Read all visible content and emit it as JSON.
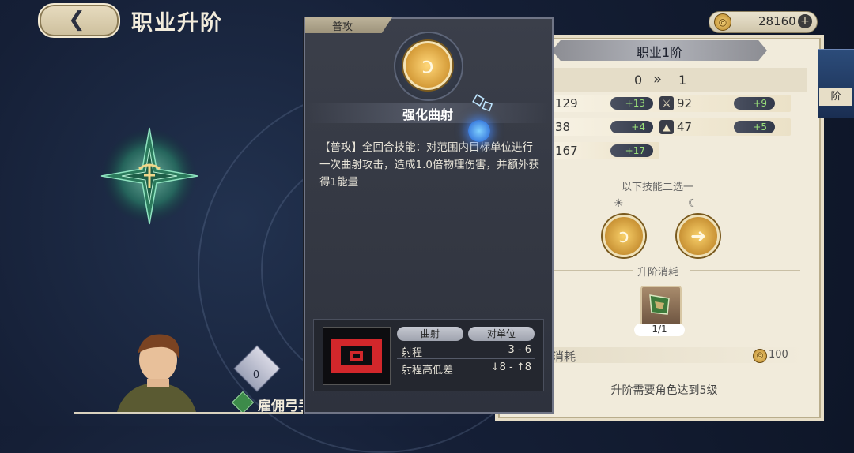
{
  "header": {
    "back_icon": "back-arrow-icon",
    "title": "职业升阶"
  },
  "currency": {
    "icon": "gold-coin-icon",
    "amount": "28160",
    "plus": "+"
  },
  "character": {
    "badge_value": "0",
    "name": "雇佣弓手",
    "class_icon": "ranger-class-icon"
  },
  "panel": {
    "title": "职业1阶",
    "rank_from": "0",
    "rank_arrow": "»",
    "rank_to": "1",
    "stats": [
      {
        "value": "129",
        "bonus": "+13",
        "icon2": "sword-icon",
        "value2": "92",
        "bonus2": "+9"
      },
      {
        "value": "38",
        "bonus": "+4",
        "icon2": "hat-icon",
        "value2": "47",
        "bonus2": "+5"
      },
      {
        "value": "167",
        "bonus": "+17"
      }
    ],
    "skill_choice_label": "以下技能二选一",
    "cost_label": "升阶消耗",
    "item_count": "1/1",
    "consume_label": "消耗",
    "consume_amount": "100",
    "requirement": "升阶需要角色达到5级",
    "side_tab": "阶"
  },
  "tooltip": {
    "tag": "普攻",
    "skill_name": "强化曲射",
    "description": "【普攻】全回合技能：对范围内目标单位进行一次曲射攻击，造成1.0倍物理伤害，并额外获得1能量",
    "range": {
      "head1": "曲射",
      "head2": "对单位",
      "row1_label": "射程",
      "row1_value": "3 - 6",
      "row2_label": "射程高低差",
      "row2_value": "↓8 - ↑8"
    }
  },
  "colors": {
    "panel_bg": "#f1ebdb",
    "tooltip_bg": "#2e323d",
    "bonus_green": "#9ae07a",
    "accent_gold": "#d9a23a"
  }
}
